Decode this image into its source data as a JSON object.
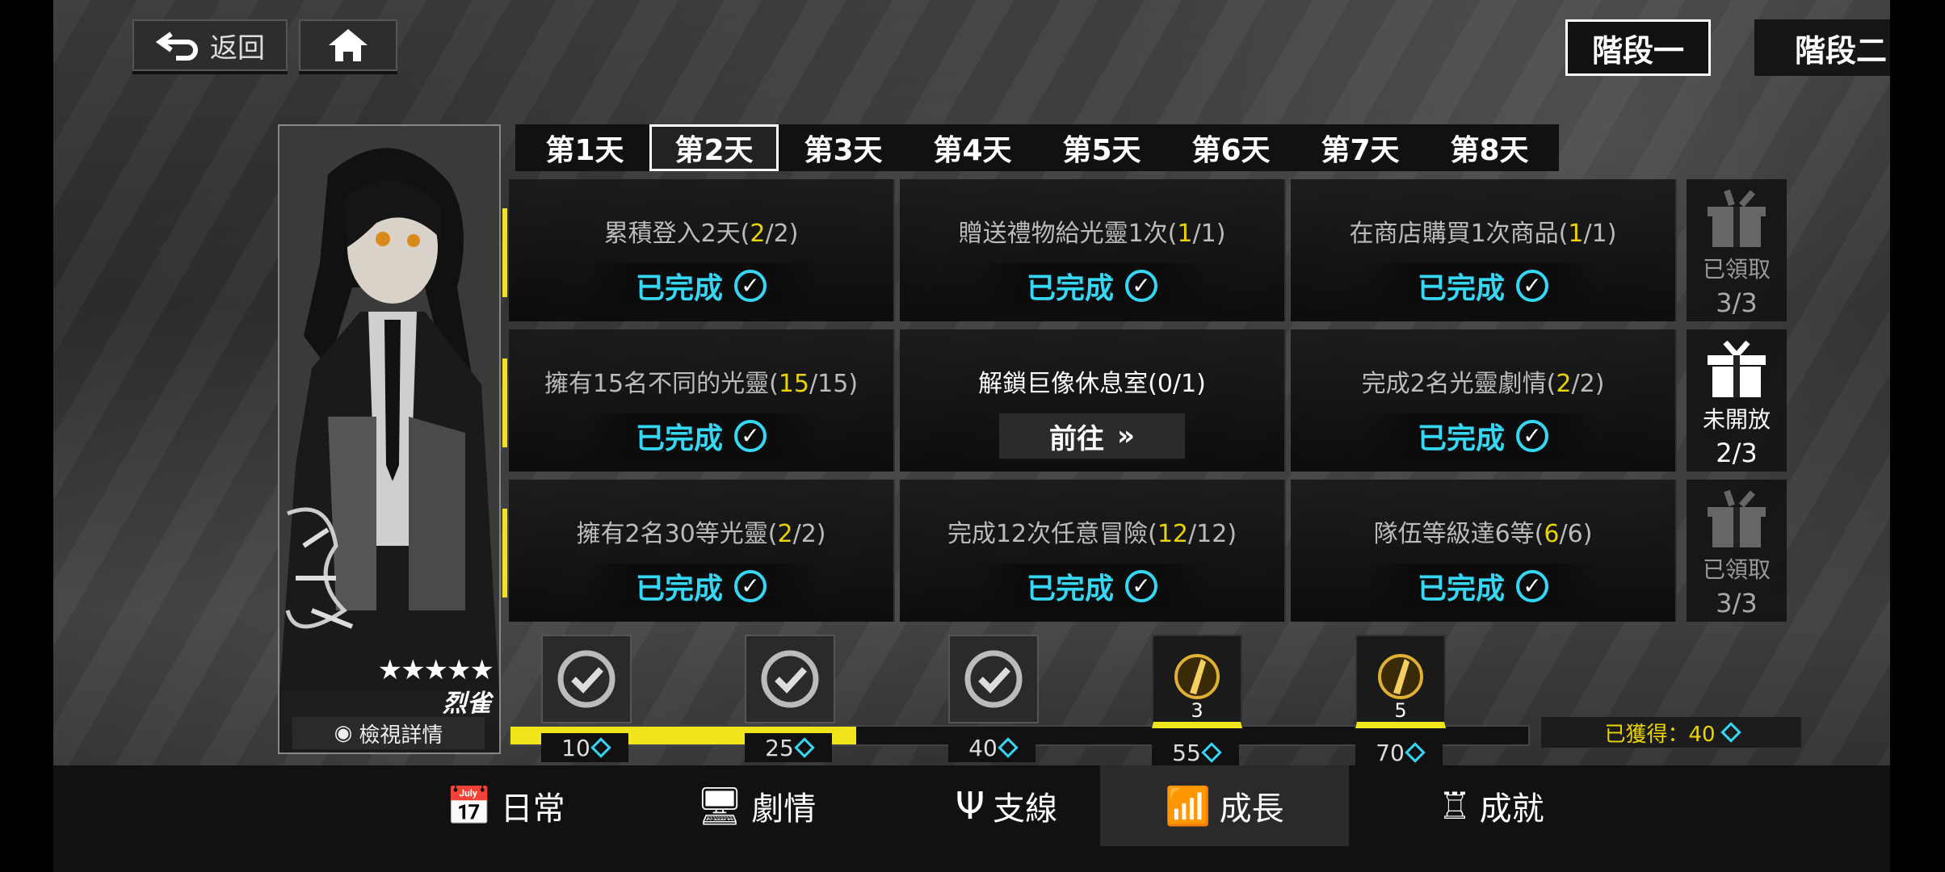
{
  "top": {
    "back_label": "返回"
  },
  "stage_tabs": [
    {
      "label": "階段一"
    },
    {
      "label": "階段二"
    }
  ],
  "character": {
    "name": "烈雀",
    "stars": "★★★★★",
    "detail_label": "檢視詳情"
  },
  "day_tabs": [
    {
      "label": "第1天"
    },
    {
      "label": "第2天"
    },
    {
      "label": "第3天"
    },
    {
      "label": "第4天"
    },
    {
      "label": "第5天"
    },
    {
      "label": "第6天"
    },
    {
      "label": "第7天"
    },
    {
      "label": "第8天"
    }
  ],
  "tasks": [
    [
      {
        "desc": "累積登入2天",
        "cur": "2",
        "tot": "2",
        "status": "已完成"
      },
      {
        "desc": "贈送禮物給光靈1次",
        "cur": "1",
        "tot": "1",
        "status": "已完成"
      },
      {
        "desc": "在商店購買1次商品",
        "cur": "1",
        "tot": "1",
        "status": "已完成"
      }
    ],
    [
      {
        "desc": "擁有15名不同的光靈",
        "cur": "15",
        "tot": "15",
        "status": "已完成"
      },
      {
        "desc": "解鎖巨像休息室(0/1)",
        "button": "前往"
      },
      {
        "desc": "完成2名光靈劇情",
        "cur": "2",
        "tot": "2",
        "status": "已完成"
      }
    ],
    [
      {
        "desc": "擁有2名30等光靈",
        "cur": "2",
        "tot": "2",
        "status": "已完成"
      },
      {
        "desc": "完成12次任意冒險",
        "cur": "12",
        "tot": "12",
        "status": "已完成"
      },
      {
        "desc": "隊伍等級達6等",
        "cur": "6",
        "tot": "6",
        "status": "已完成"
      }
    ]
  ],
  "gifts": [
    {
      "label": "已領取",
      "count": "3/3"
    },
    {
      "label": "未開放",
      "count": "2/3"
    },
    {
      "label": "已領取",
      "count": "3/3"
    }
  ],
  "milestones": [
    {
      "points": "10",
      "claimed": true
    },
    {
      "points": "25",
      "claimed": true
    },
    {
      "points": "40",
      "claimed": true
    },
    {
      "points": "55",
      "claimed": false,
      "qty": "3"
    },
    {
      "points": "70",
      "claimed": false,
      "qty": "5"
    }
  ],
  "progress": {
    "fraction": 0.34,
    "earned_label": "已獲得：40"
  },
  "nav": [
    {
      "label": "日常",
      "icon": "calendar-icon"
    },
    {
      "label": "劇情",
      "icon": "story-icon"
    },
    {
      "label": "支線",
      "icon": "branch-icon"
    },
    {
      "label": "成長",
      "icon": "growth-icon"
    },
    {
      "label": "成就",
      "icon": "trophy-icon"
    }
  ],
  "colors": {
    "accent_yellow": "#f0e51b",
    "accent_cyan": "#35d7f4"
  }
}
